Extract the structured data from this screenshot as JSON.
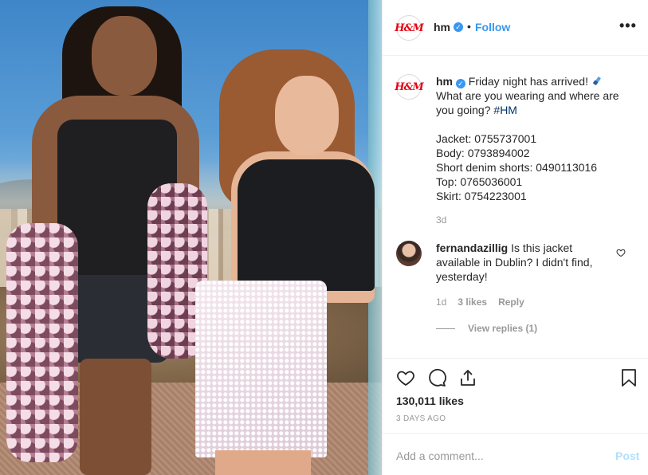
{
  "header": {
    "avatar_text": "H&M",
    "username": "hm",
    "separator": "•",
    "follow_label": "Follow",
    "more_label": "•••"
  },
  "caption": {
    "username": "hm",
    "line1": "Friday night has arrived!",
    "line2": "What are you wearing and where are you going?",
    "hashtag": "#HM",
    "items": [
      "Jacket: 0755737001",
      "Body: 0793894002",
      "Short denim shorts: 0490113016",
      "Top: 0765036001",
      "Skirt: 0754223001"
    ],
    "age": "3d"
  },
  "comment": {
    "username": "fernandazillig",
    "text": "Is this jacket available in Dublin? I didn't find, yesterday!",
    "age": "1d",
    "likes": "3 likes",
    "reply_label": "Reply",
    "view_replies": "View replies (1)"
  },
  "actions": {
    "likes": "130,011 likes",
    "date": "3 DAYS AGO"
  },
  "add_comment": {
    "placeholder": "Add a comment...",
    "post_label": "Post"
  },
  "colors": {
    "accent": "#3897f0",
    "brand": "#e50010",
    "muted": "#999999",
    "post_disabled": "#b2dffc"
  }
}
